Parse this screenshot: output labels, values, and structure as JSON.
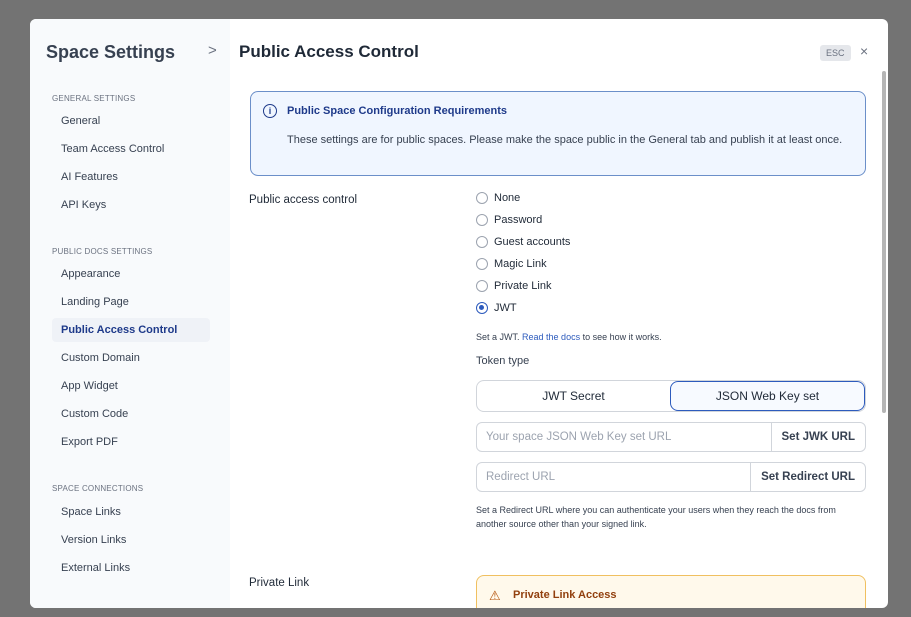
{
  "header": {
    "title": "Space Settings",
    "page_title": "Public Access Control",
    "esc_label": "ESC",
    "close_glyph": "×"
  },
  "sidebar": {
    "sections": [
      {
        "title": "GENERAL SETTINGS",
        "items": [
          "General",
          "Team Access Control",
          "AI Features",
          "API Keys"
        ]
      },
      {
        "title": "PUBLIC DOCS SETTINGS",
        "items": [
          "Appearance",
          "Landing Page",
          "Public Access Control",
          "Custom Domain",
          "App Widget",
          "Custom Code",
          "Export PDF"
        ]
      },
      {
        "title": "SPACE CONNECTIONS",
        "items": [
          "Space Links",
          "Version Links",
          "External Links"
        ]
      }
    ],
    "active_item": "Public Access Control"
  },
  "info_box": {
    "icon": "info-icon",
    "title": "Public Space Configuration Requirements",
    "body": "These settings are for public spaces. Please make the space public in the General tab and publish it at least once."
  },
  "access_control": {
    "label": "Public access control",
    "options": [
      "None",
      "Password",
      "Guest accounts",
      "Magic Link",
      "Private Link",
      "JWT"
    ],
    "selected": "JWT",
    "hint_prefix": "Set a JWT.",
    "hint_link": "Read the docs",
    "hint_suffix": "to see how it works."
  },
  "token": {
    "label": "Token type",
    "options": [
      "JWT Secret",
      "JSON Web Key set"
    ],
    "selected": "JSON Web Key set"
  },
  "jwk_field": {
    "value": "",
    "placeholder": "Your space JSON Web Key set URL",
    "button": "Set JWK URL"
  },
  "redirect_field": {
    "value": "",
    "placeholder": "Redirect URL",
    "button": "Set Redirect URL"
  },
  "redirect_hint": "Set a Redirect URL where you can authenticate your users when they reach the docs from another source other than your signed link.",
  "private_link": {
    "label": "Private Link",
    "warning_title": "Private Link Access",
    "warning_icon": "warning-icon"
  },
  "colors": {
    "accent": "#2d5bbd",
    "info_border": "#6b8fc9",
    "warning_border": "#f0c060"
  }
}
